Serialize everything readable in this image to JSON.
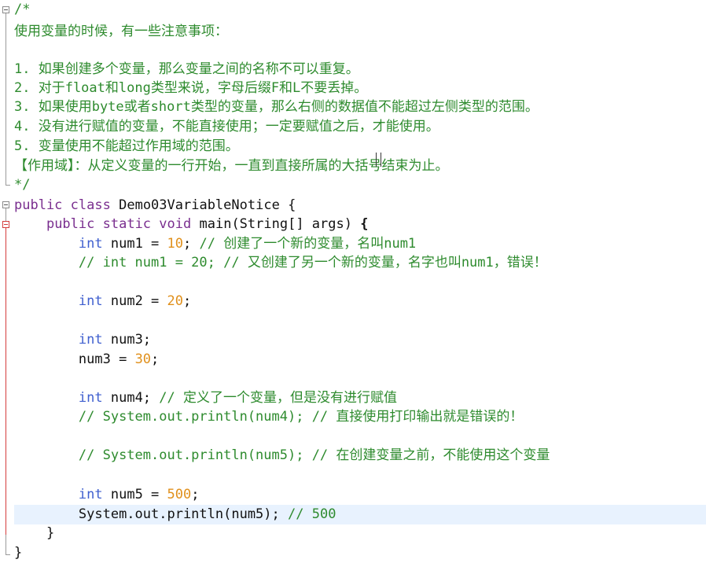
{
  "editor": {
    "comment_block": {
      "open": "/*",
      "intro": "使用变量的时候，有一些注意事项：",
      "notes": [
        "1. 如果创建多个变量，那么变量之间的名称不可以重复。",
        "2. 对于float和long类型来说，字母后缀F和L不要丢掉。",
        "3. 如果使用byte或者short类型的变量，那么右侧的数据值不能超过左侧类型的范围。",
        "4. 没有进行赋值的变量，不能直接使用；一定要赋值之后，才能使用。",
        "5. 变量使用不能超过作用域的范围。"
      ],
      "scope": "【作用域】：从定义变量的一行开始，一直到直接所属的大括号结束为止。",
      "close": "*/"
    },
    "class_decl": {
      "kw_public": "public",
      "kw_class": "class",
      "name": "Demo03VariableNotice",
      "brace": "{"
    },
    "method_decl": {
      "kw_public": "public",
      "kw_static": "static",
      "kw_void": "void",
      "sig": "main(String[] args)",
      "brace": "{"
    },
    "code": {
      "l1_type": "int",
      "l1_decl": "num1 =",
      "l1_num": "10",
      "l1_semi": ";",
      "l1_comment": "// 创建了一个新的变量，名叫num1",
      "l2_comment": "// int num1 = 20; // 又创建了另一个新的变量，名字也叫num1，错误！",
      "l3_type": "int",
      "l3_decl": "num2 =",
      "l3_num": "20",
      "l3_semi": ";",
      "l4_type": "int",
      "l4_decl": "num3;",
      "l5_decl": "num3 =",
      "l5_num": "30",
      "l5_semi": ";",
      "l6_type": "int",
      "l6_decl": "num4;",
      "l6_comment": "// 定义了一个变量，但是没有进行赋值",
      "l7_comment": "// System.out.println(num4); // 直接使用打印输出就是错误的！",
      "l8_comment": "// System.out.println(num5); // 在创建变量之前，不能使用这个变量",
      "l9_type": "int",
      "l9_decl": "num5 =",
      "l9_num": "500",
      "l9_semi": ";",
      "l10_stmt": "System.out.println(num5);",
      "l10_comment": "// 500",
      "method_close": "}",
      "class_close": "}"
    },
    "colors": {
      "comment": "#2e8b2e",
      "keyword": "#7a2f8f",
      "type": "#3f5fcf",
      "number": "#e0901c",
      "current_line": "#e8f2fe",
      "fold_marker": "#d43c3c"
    }
  }
}
